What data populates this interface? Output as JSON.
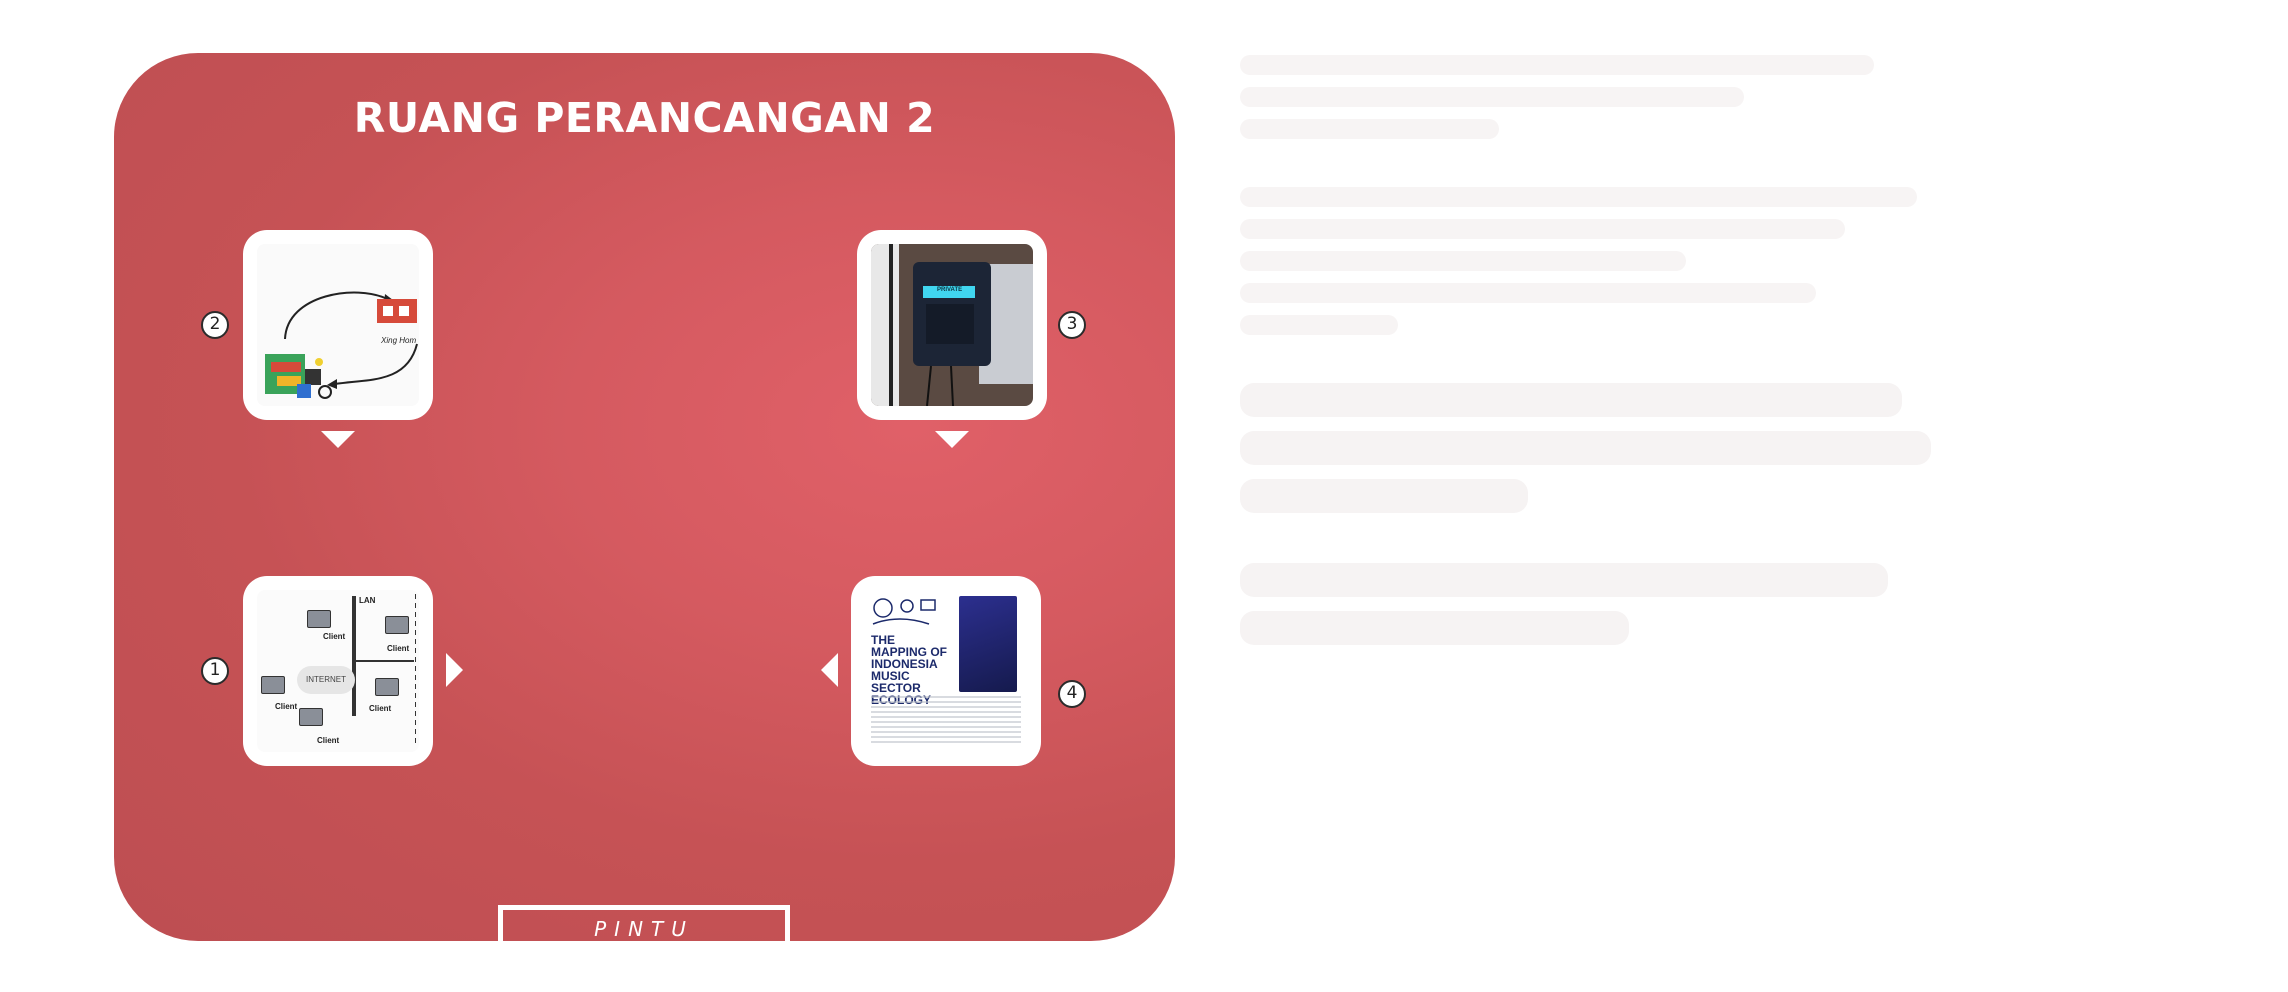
{
  "room": {
    "title": "RUANG PERANCANGAN 2",
    "door_label": "PINTU",
    "background_color": "#c9545a"
  },
  "cards": [
    {
      "number": "2",
      "thumbnail": "supply-chain-diagram",
      "thumb_text": "Xing Hom"
    },
    {
      "number": "3",
      "thumbnail": "device-photo",
      "thumb_text": "PRIVATE"
    },
    {
      "number": "1",
      "thumbnail": "network-diagram",
      "labels": {
        "lan": "LAN",
        "internet": "INTERNET",
        "client": "Client"
      }
    },
    {
      "number": "4",
      "thumbnail": "report-cover",
      "doc_title": "THE MAPPING OF INDONESIA MUSIC SECTOR ECOLOGY"
    }
  ]
}
